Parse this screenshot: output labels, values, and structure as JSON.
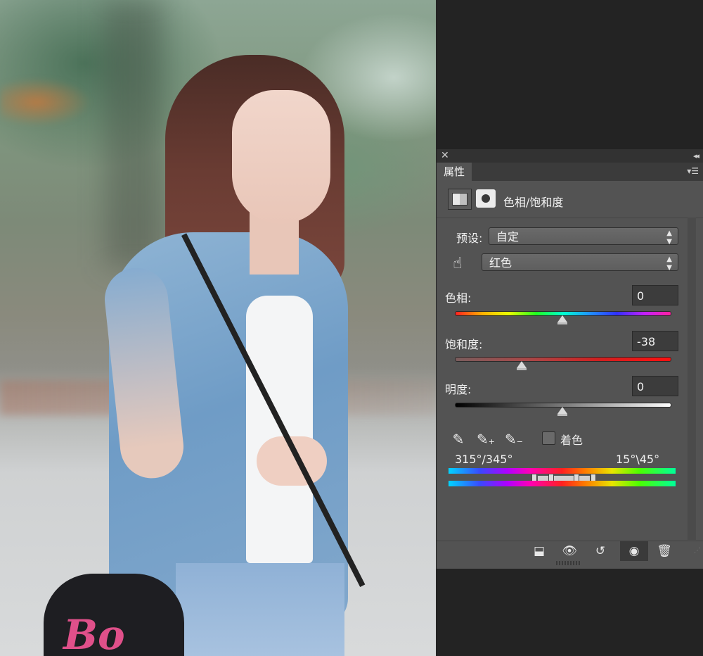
{
  "panel": {
    "tab_label": "属性",
    "adjustment_title": "色相/饱和度",
    "preset": {
      "label": "预设:",
      "value": "自定"
    },
    "channel": {
      "value": "红色"
    },
    "hue": {
      "label": "色相:",
      "value": "0",
      "slider_fraction": 0.5
    },
    "saturation": {
      "label": "饱和度:",
      "value": "-38",
      "slider_fraction": 0.31
    },
    "lightness": {
      "label": "明度:",
      "value": "0",
      "slider_fraction": 0.5
    },
    "colorize": {
      "label": "着色",
      "checked": false
    },
    "range_left": "315°/345°",
    "range_right": "15°\\45°"
  },
  "icons": {
    "close": "close-icon",
    "collapse": "collapse-icon",
    "menu": "panel-menu-icon",
    "adjustment": "hue-saturation-icon",
    "mask": "mask-icon",
    "hand": "targeted-adjustment-icon",
    "eyedropper": "eyedropper-icon",
    "eyedropper_add": "eyedropper-plus-icon",
    "eyedropper_sub": "eyedropper-minus-icon",
    "clip": "clip-to-layer-icon",
    "view_previous": "view-previous-icon",
    "reset": "reset-icon",
    "visibility": "eye-icon",
    "delete": "trash-icon"
  },
  "colors": {
    "panel_bg": "#535353",
    "hue_track": "rainbow",
    "saturation_track": "red",
    "lightness_track": "black-to-white"
  }
}
